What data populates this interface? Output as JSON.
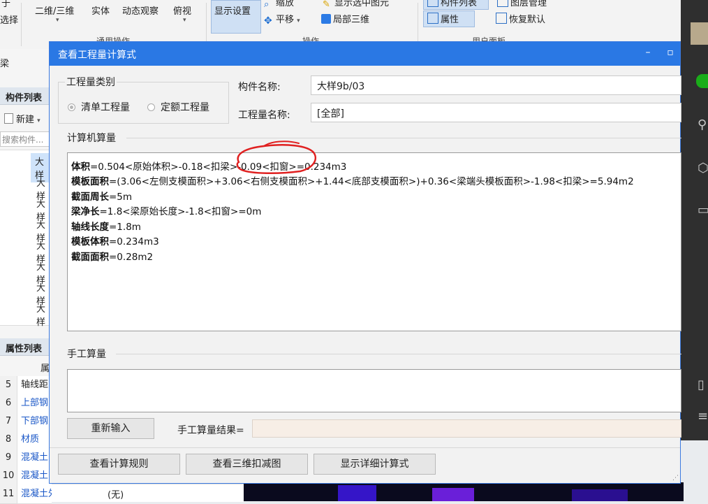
{
  "ribbon": {
    "select_label": "选择",
    "view_2d3d": "二维/三维",
    "solid": "实体",
    "dynamic_view": "动态观察",
    "top_view": "俯视",
    "common_ops_group": "通用操作",
    "display_settings": "显示设置",
    "zoom": "缩放",
    "pan": "平移",
    "show_selected": "显示选中图元",
    "local_3d": "局部三维",
    "ops_group": "操作",
    "component_list": "构件列表",
    "layer_mgmt": "图层管理",
    "properties": "属性",
    "restore_default": "恢复默认",
    "user_panel_group": "用户面板",
    "top_char": "于"
  },
  "left_panel": {
    "top_text": "梁",
    "component_list_title": "构件列表",
    "new_label": "新建",
    "search_placeholder": "搜索构件...",
    "tree_items": [
      "大样",
      "大样",
      "大样",
      "大样",
      "大样",
      "大样",
      "大样",
      "大样"
    ],
    "property_list_title": "属性列表",
    "property_header": "属",
    "properties": [
      {
        "num": "5",
        "name": "轴线距",
        "blue": false
      },
      {
        "num": "6",
        "name": "上部钢",
        "blue": true
      },
      {
        "num": "7",
        "name": "下部钢",
        "blue": true
      },
      {
        "num": "8",
        "name": "材质",
        "blue": true
      },
      {
        "num": "9",
        "name": "混凝土",
        "blue": true
      },
      {
        "num": "10",
        "name": "混凝土",
        "blue": true
      },
      {
        "num": "11",
        "name": "混凝土外加剂",
        "blue": true
      }
    ],
    "additive_value": "(无)"
  },
  "dialog": {
    "title": "查看工程量计算式",
    "qty_type_legend": "工程量类别",
    "radio_list": "清单工程量",
    "radio_quota": "定额工程量",
    "component_name_label": "构件名称:",
    "component_name_value": "大样9b/03",
    "qty_name_label": "工程量名称:",
    "qty_name_value": "[全部]",
    "computer_calc_label": "计算机算量",
    "calc_lines": [
      {
        "key": "体积",
        "expr": "=0.504<原始体积>-0.18<扣梁>-0.09<扣窗>=0.234m3"
      },
      {
        "key": "模板面积",
        "expr": "=(3.06<左侧支模面积>+3.06<右侧支模面积>+1.44<底部支模面积>)+0.36<梁端头模板面积>-1.98<扣梁>=5.94m2"
      },
      {
        "key": "截面周长",
        "expr": "=5m"
      },
      {
        "key": "梁净长",
        "expr": "=1.8<梁原始长度>-1.8<扣窗>=0m"
      },
      {
        "key": "轴线长度",
        "expr": "=1.8m"
      },
      {
        "key": "模板体积",
        "expr": "=0.234m3"
      },
      {
        "key": "截面面积",
        "expr": "=0.28m2"
      }
    ],
    "manual_calc_label": "手工算量",
    "reenter_button": "重新输入",
    "manual_result_label": "手工算量结果=",
    "manual_result_value": "",
    "btn_view_rules": "查看计算规则",
    "btn_view_3d": "查看三维扣减图",
    "btn_show_detail": "显示详细计算式",
    "minimize_glyph": "–",
    "maximize_glyph": "▫"
  },
  "colors": {
    "titlebar": "#2a78e4",
    "annotation": "#e02020",
    "link_blue": "#1a57c7"
  }
}
